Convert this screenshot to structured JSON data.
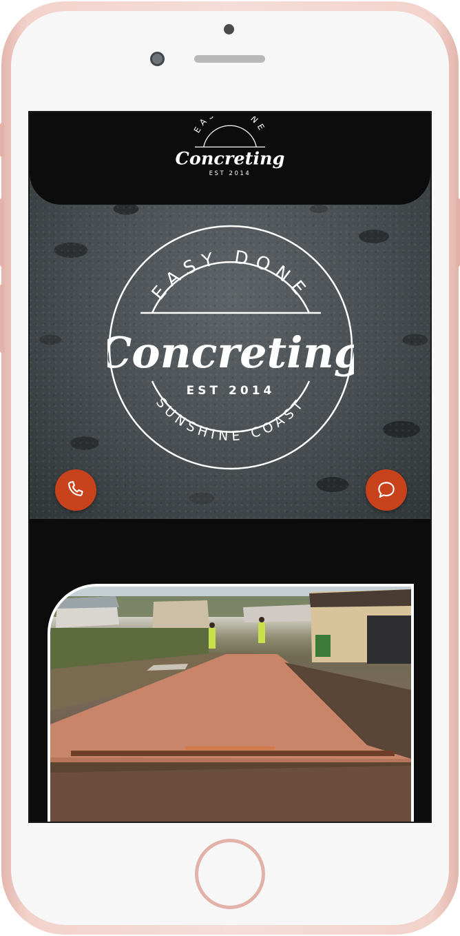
{
  "logo": {
    "line1": "EASY DONE",
    "name": "Concreting",
    "est": "EST 2014",
    "region": "SUNSHINE COAST"
  },
  "actions": {
    "call_icon": "phone-icon",
    "chat_icon": "chat-bubble-icon"
  },
  "colors": {
    "frame": "#f2d3cc",
    "accent": "#c8431c",
    "header": "#0c0c0c",
    "driveway": "#c9856a"
  }
}
